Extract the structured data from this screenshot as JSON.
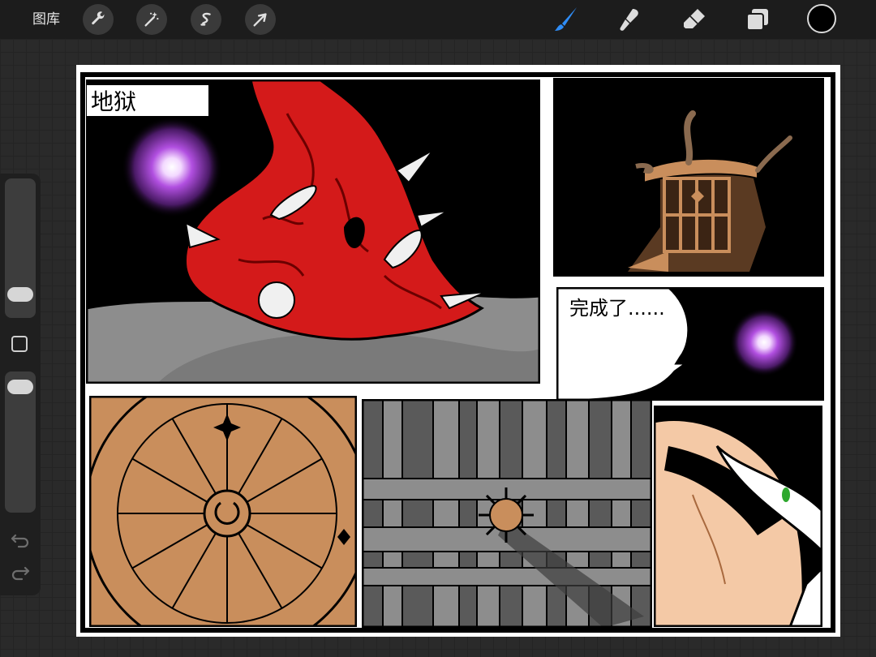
{
  "toolbar": {
    "gallery_label": "图库",
    "left_tools": [
      "wrench-icon",
      "magic-wand-icon",
      "selection-icon",
      "transform-arrow-icon"
    ],
    "right_tools": [
      "brush-icon",
      "smudge-icon",
      "eraser-icon",
      "layers-icon"
    ],
    "active_tool": "brush-icon",
    "active_tool_color": "#2f8cf5",
    "current_color": "#000000"
  },
  "sidebar": {
    "brush_size_level": 0.1,
    "opacity_level": 0.97,
    "undo_icon": "undo-icon",
    "redo_icon": "redo-icon"
  },
  "canvas": {
    "panel1_caption": "地狱",
    "panel3_caption": "完成了......"
  },
  "colors": {
    "creature_red": "#d41a1a",
    "portal_purple": "#b14fe0",
    "parchment": "#c98e5c",
    "stone_grey": "#8d8d8d",
    "skin": "#f4c9a6"
  }
}
